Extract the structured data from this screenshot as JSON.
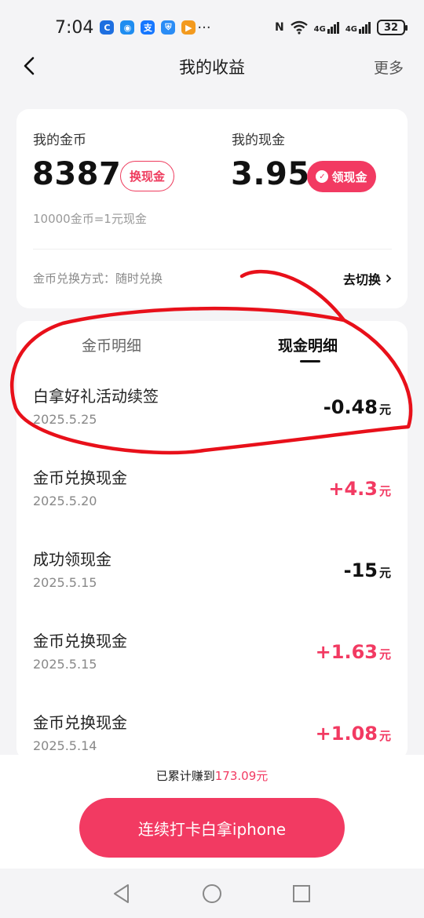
{
  "status_bar": {
    "time": "7:04",
    "app_icons": [
      {
        "name": "app-c-icon",
        "glyph": "C",
        "color": "#1e6fe0"
      },
      {
        "name": "chat-app-icon",
        "glyph": "◉",
        "color": "#1f8df0"
      },
      {
        "name": "alipay-icon",
        "glyph": "支",
        "color": "#1677ff"
      },
      {
        "name": "shield-app-icon",
        "glyph": "⛨",
        "color": "#2a8cf5"
      },
      {
        "name": "play-app-icon",
        "glyph": "▶",
        "color": "#f39a1e"
      }
    ],
    "more": "···",
    "nfc": "N",
    "signal1": "4G",
    "signal2": "4G",
    "battery": "32"
  },
  "nav": {
    "title": "我的收益",
    "more": "更多"
  },
  "summary": {
    "coins_label": "我的金币",
    "coins_value": "8387",
    "exchange_button": "换现金",
    "cash_label": "我的现金",
    "cash_value": "3.95",
    "withdraw_button": "领现金",
    "rate": "10000金币=1元现金",
    "method": "金币兑换方式：随时兑换",
    "switch_label": "去切换"
  },
  "tabs": {
    "coin_detail": "金币明细",
    "cash_detail": "现金明细",
    "active": "cash_detail"
  },
  "transactions": [
    {
      "title": "白拿好礼活动续签",
      "date": "2025.5.25",
      "amount": "-0.48",
      "unit": "元",
      "positive": false
    },
    {
      "title": "金币兑换现金",
      "date": "2025.5.20",
      "amount": "+4.3",
      "unit": "元",
      "positive": true
    },
    {
      "title": "成功领现金",
      "date": "2025.5.15",
      "amount": "-15",
      "unit": "元",
      "positive": false
    },
    {
      "title": "金币兑换现金",
      "date": "2025.5.15",
      "amount": "+1.63",
      "unit": "元",
      "positive": true
    },
    {
      "title": "金币兑换现金",
      "date": "2025.5.14",
      "amount": "+1.08",
      "unit": "元",
      "positive": true
    }
  ],
  "footer": {
    "total_prefix": "已累计赚到",
    "total_value": "173.09元",
    "cta": "连续打卡白拿iphone"
  },
  "colors": {
    "accent": "#f23a62",
    "annotation": "#e8101a"
  }
}
